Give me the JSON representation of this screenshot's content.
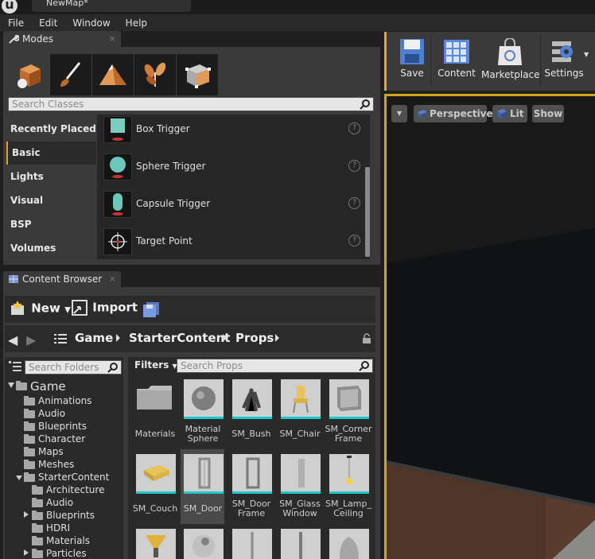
{
  "window": {
    "title": "NewMap*"
  },
  "menu": [
    "File",
    "Edit",
    "Window",
    "Help"
  ],
  "modes": {
    "tab_label": "Modes",
    "close": "×",
    "search_placeholder": "Search Classes",
    "categories": [
      "Recently Placed",
      "Basic",
      "Lights",
      "Visual",
      "BSP",
      "Volumes"
    ],
    "selected_category": "Basic",
    "items": [
      {
        "label": "Box Trigger",
        "help": "?"
      },
      {
        "label": "Sphere Trigger",
        "help": "?"
      },
      {
        "label": "Capsule Trigger",
        "help": "?"
      },
      {
        "label": "Target Point",
        "help": "?"
      }
    ]
  },
  "content_browser": {
    "tab_label": "Content Browser",
    "close": "×",
    "new_label": "New",
    "import_label": "Import",
    "path": [
      "Game",
      "StarterContent",
      "Props"
    ],
    "folder_search_placeholder": "Search Folders",
    "filters_label": "Filters",
    "search_placeholder": "Search Props",
    "folders": {
      "root": "Game",
      "level1": [
        "Animations",
        "Audio",
        "Blueprints",
        "Character",
        "Maps",
        "Meshes",
        "StarterContent"
      ],
      "starter": [
        "Architecture",
        "Audio",
        "Blueprints",
        "HDRI",
        "Materials",
        "Particles"
      ]
    },
    "assets": [
      {
        "name": "Materials",
        "kind": "folder"
      },
      {
        "name": "Material Sphere",
        "kind": "sphere"
      },
      {
        "name": "SM_Bush",
        "kind": "bush"
      },
      {
        "name": "SM_Chair",
        "kind": "chair"
      },
      {
        "name": "SM_Corner Frame",
        "kind": "frame"
      },
      {
        "name": "SM_Couch",
        "kind": "couch"
      },
      {
        "name": "SM_Door",
        "kind": "door"
      },
      {
        "name": "SM_Door Frame",
        "kind": "doorframe"
      },
      {
        "name": "SM_Glass Window",
        "kind": "glass"
      },
      {
        "name": "SM_Lamp_ Ceiling",
        "kind": "lamp"
      }
    ],
    "selected_asset": "SM_Door"
  },
  "toolbar": {
    "buttons": [
      "Save",
      "Content",
      "Marketplace",
      "Settings"
    ]
  },
  "viewport": {
    "perspective_label": "Perspective",
    "lit_label": "Lit",
    "show_label": "Show"
  },
  "colors": {
    "accent": "#e4a81c",
    "asset_underline": "#1fc8c8"
  }
}
